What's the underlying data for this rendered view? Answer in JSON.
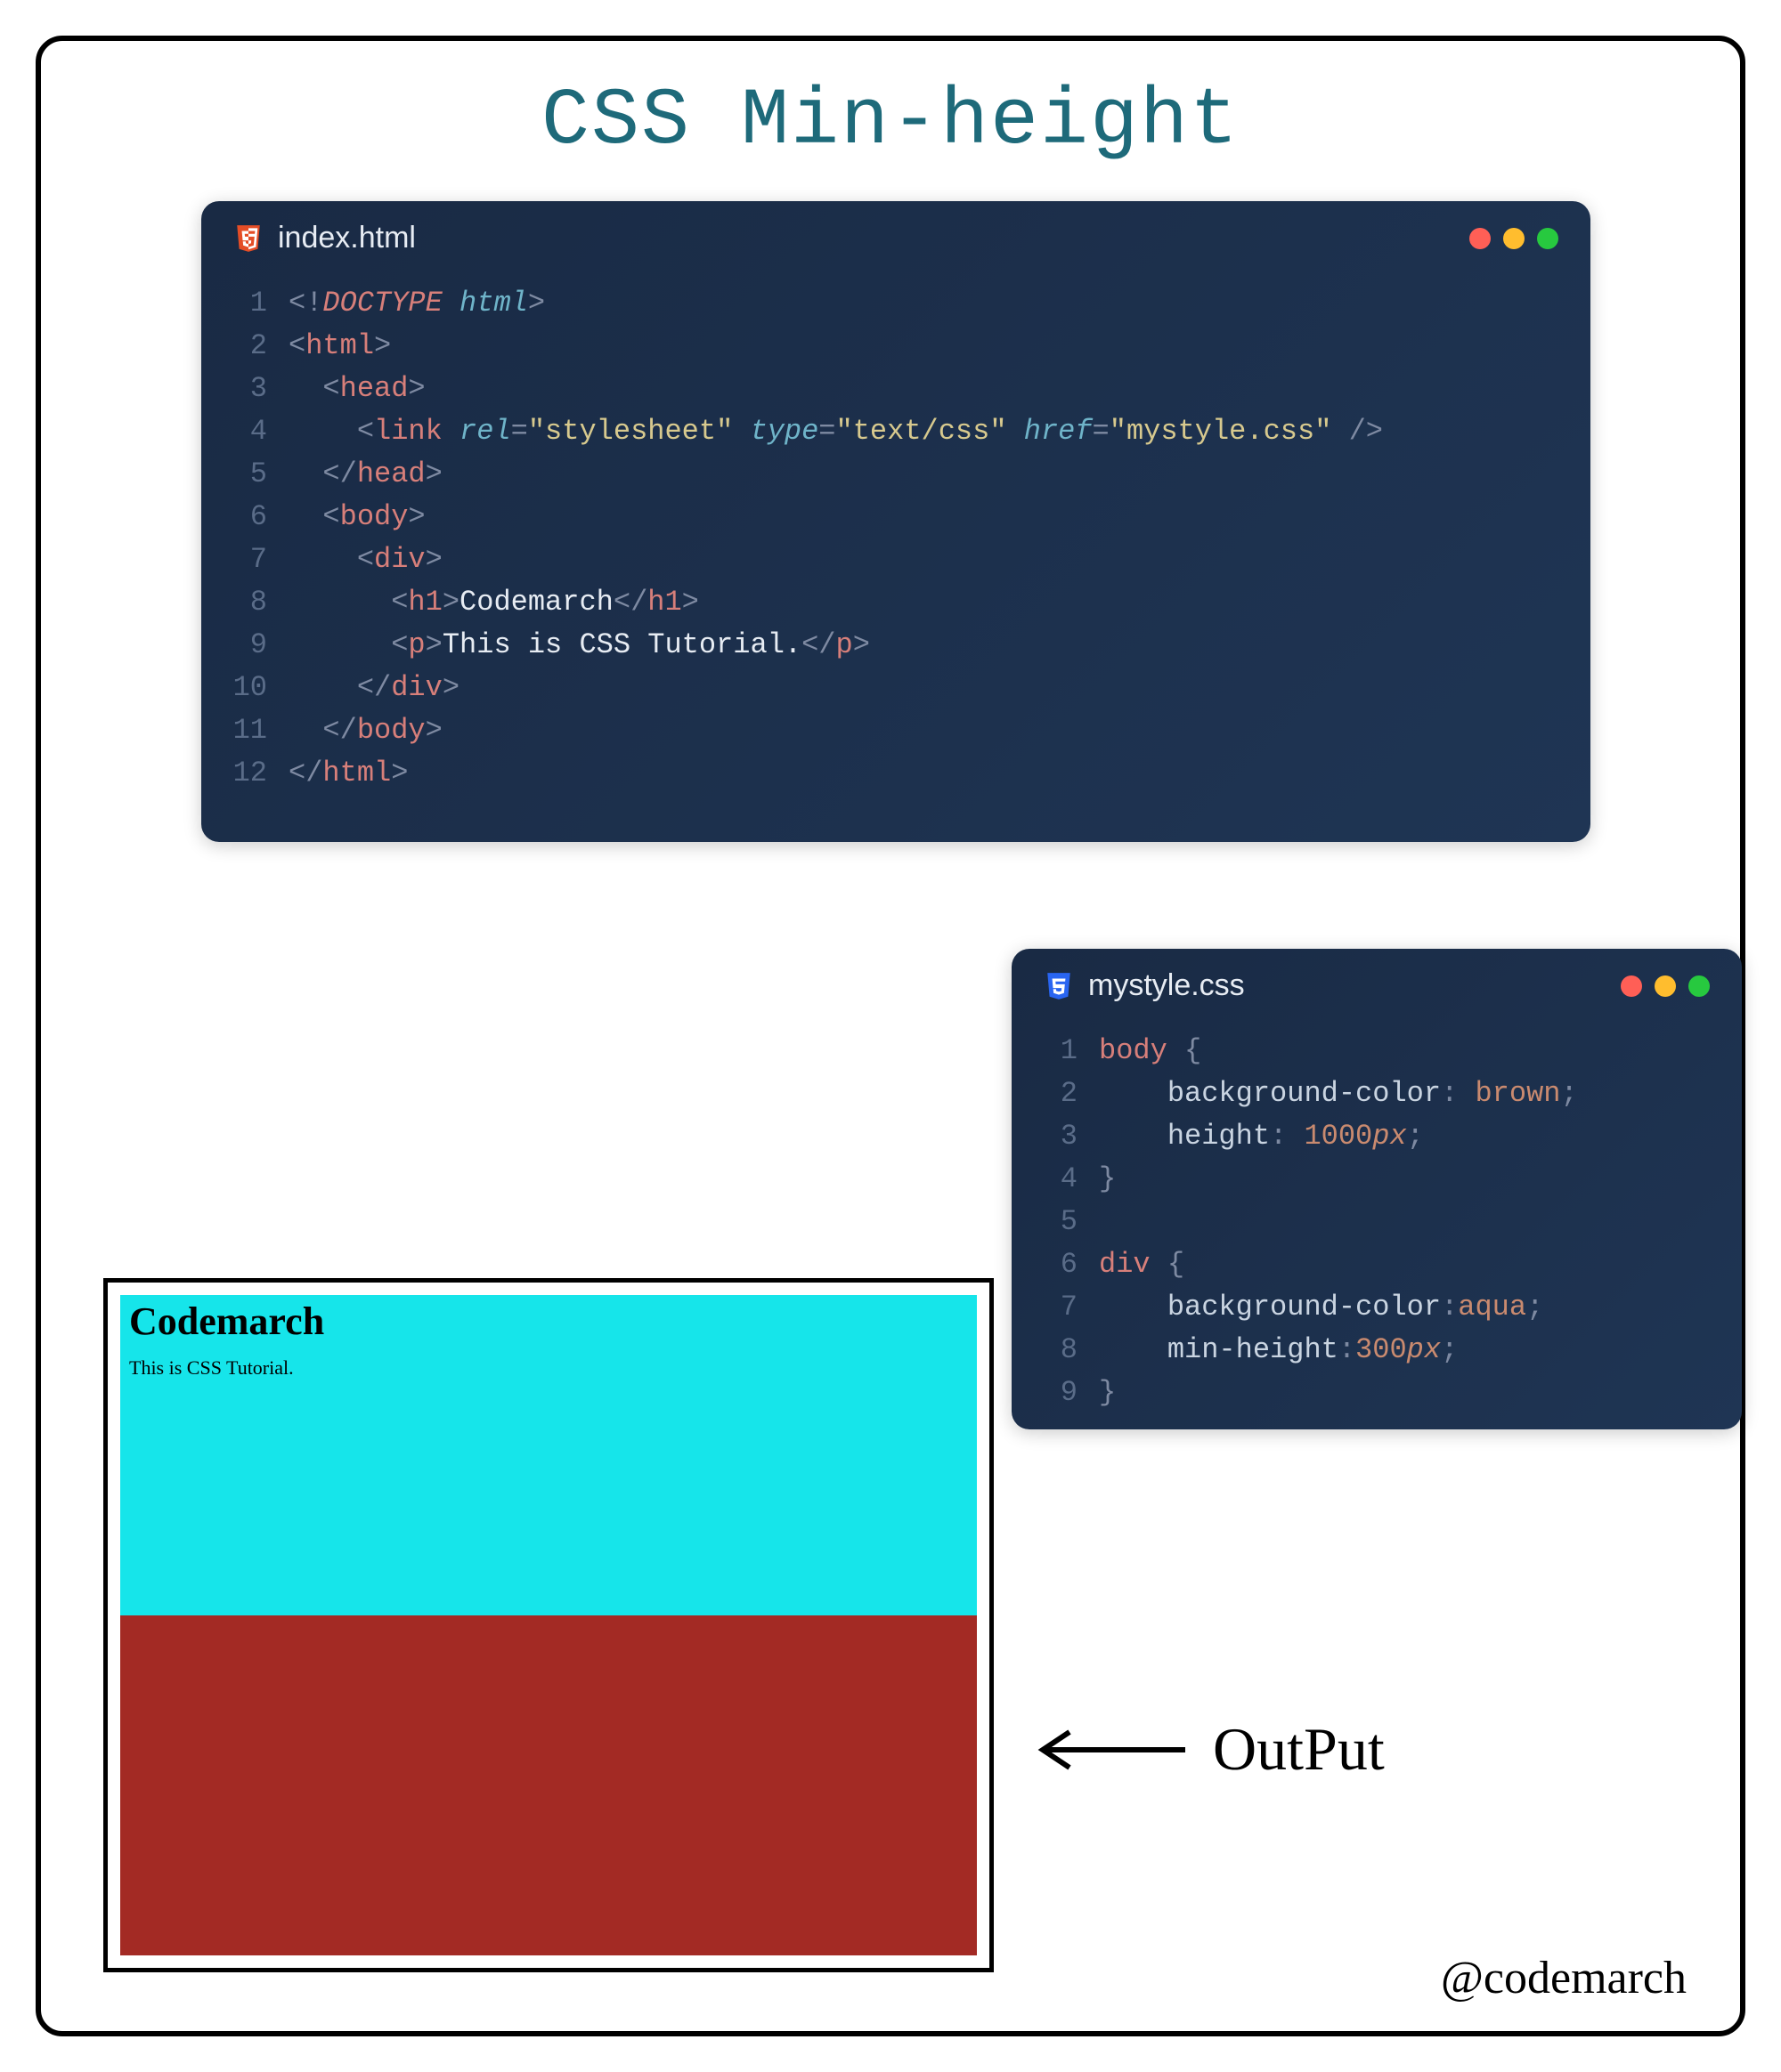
{
  "title": "CSS Min-height",
  "files": {
    "html": {
      "name": "index.html",
      "icon": "html5-icon"
    },
    "css": {
      "name": "mystyle.css",
      "icon": "css3-icon"
    }
  },
  "html_code": {
    "line1": {
      "n": "1",
      "doctype": "DOCTYPE",
      "html": "html"
    },
    "line2": {
      "n": "2",
      "tag": "html"
    },
    "line3": {
      "n": "3",
      "tag": "head"
    },
    "line4": {
      "n": "4",
      "tag": "link",
      "attr_rel": "rel",
      "val_rel": "\"stylesheet\"",
      "attr_type": "type",
      "val_type": "\"text/css\"",
      "attr_href": "href",
      "val_href": "\"mystyle.css\""
    },
    "line5": {
      "n": "5",
      "tag": "head"
    },
    "line6": {
      "n": "6",
      "tag": "body"
    },
    "line7": {
      "n": "7",
      "tag": "div"
    },
    "line8": {
      "n": "8",
      "tag": "h1",
      "text": "Codemarch"
    },
    "line9": {
      "n": "9",
      "tag": "p",
      "text": "This is CSS Tutorial."
    },
    "line10": {
      "n": "10",
      "tag": "div"
    },
    "line11": {
      "n": "11",
      "tag": "body"
    },
    "line12": {
      "n": "12",
      "tag": "html"
    }
  },
  "css_code": {
    "line1": {
      "n": "1",
      "sel": "body",
      "brace": "{"
    },
    "line2": {
      "n": "2",
      "prop": "background-color",
      "val": "brown"
    },
    "line3": {
      "n": "3",
      "prop": "height",
      "num": "1000",
      "unit": "px"
    },
    "line4": {
      "n": "4",
      "brace": "}"
    },
    "line5": {
      "n": "5"
    },
    "line6": {
      "n": "6",
      "sel": "div",
      "brace": "{"
    },
    "line7": {
      "n": "7",
      "prop": "background-color",
      "val": "aqua"
    },
    "line8": {
      "n": "8",
      "prop": "min-height",
      "num": "300",
      "unit": "px"
    },
    "line9": {
      "n": "9",
      "brace": "}"
    }
  },
  "output": {
    "h1": "Codemarch",
    "p": "This is CSS Tutorial.",
    "label": "OutPut"
  },
  "handle": "@codemarch"
}
